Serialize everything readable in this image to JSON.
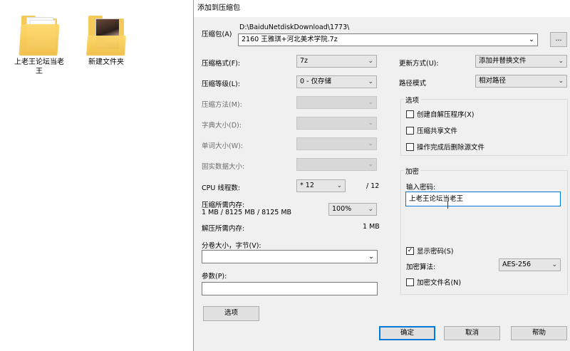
{
  "desktop": {
    "icons": [
      {
        "label": "上老王论坛当老王"
      },
      {
        "label": "新建文件夹"
      }
    ]
  },
  "dialog": {
    "title": "添加到压缩包",
    "archive": {
      "label": "压缩包(A)",
      "path": "D:\\BaiduNetdiskDownload\\1773\\",
      "filename": "2160 王雅琪+河北美术学院.7z",
      "browse": "..."
    },
    "format": {
      "label": "压缩格式(F):",
      "value": "7z"
    },
    "level": {
      "label": "压缩等级(L):",
      "value": "0 - 仅存储"
    },
    "method": {
      "label": "压缩方法(M):"
    },
    "dict": {
      "label": "字典大小(D):"
    },
    "word": {
      "label": "单词大小(W):"
    },
    "solid": {
      "label": "固实数据大小:"
    },
    "cpu": {
      "label": "CPU 线程数:",
      "value": "* 12",
      "max": "/ 12"
    },
    "mem_compress": {
      "label": "压缩所需内存:",
      "detail": "1 MB / 8125 MB / 8125 MB",
      "percent": "100%"
    },
    "mem_decompress": {
      "label": "解压所需内存:",
      "value": "1 MB"
    },
    "split": {
      "label": "分卷大小，字节(V):",
      "value": ""
    },
    "params": {
      "label": "参数(P):",
      "value": ""
    },
    "options_button": "选项",
    "update": {
      "label": "更新方式(U):",
      "value": "添加并替换文件"
    },
    "pathmode": {
      "label": "路径模式",
      "value": "相对路径"
    },
    "options_group": {
      "title": "选项",
      "sfx": "创建自解压程序(X)",
      "shared": "压缩共享文件",
      "delete": "操作完成后删除源文件"
    },
    "encryption": {
      "title": "加密",
      "password_label": "输入密码:",
      "password": "上老王论坛当老王",
      "show_password": "显示密码(S)",
      "method_label": "加密算法:",
      "method": "AES-256",
      "encrypt_names": "加密文件名(N)"
    },
    "buttons": {
      "ok": "确定",
      "cancel": "取消",
      "help": "帮助"
    }
  }
}
